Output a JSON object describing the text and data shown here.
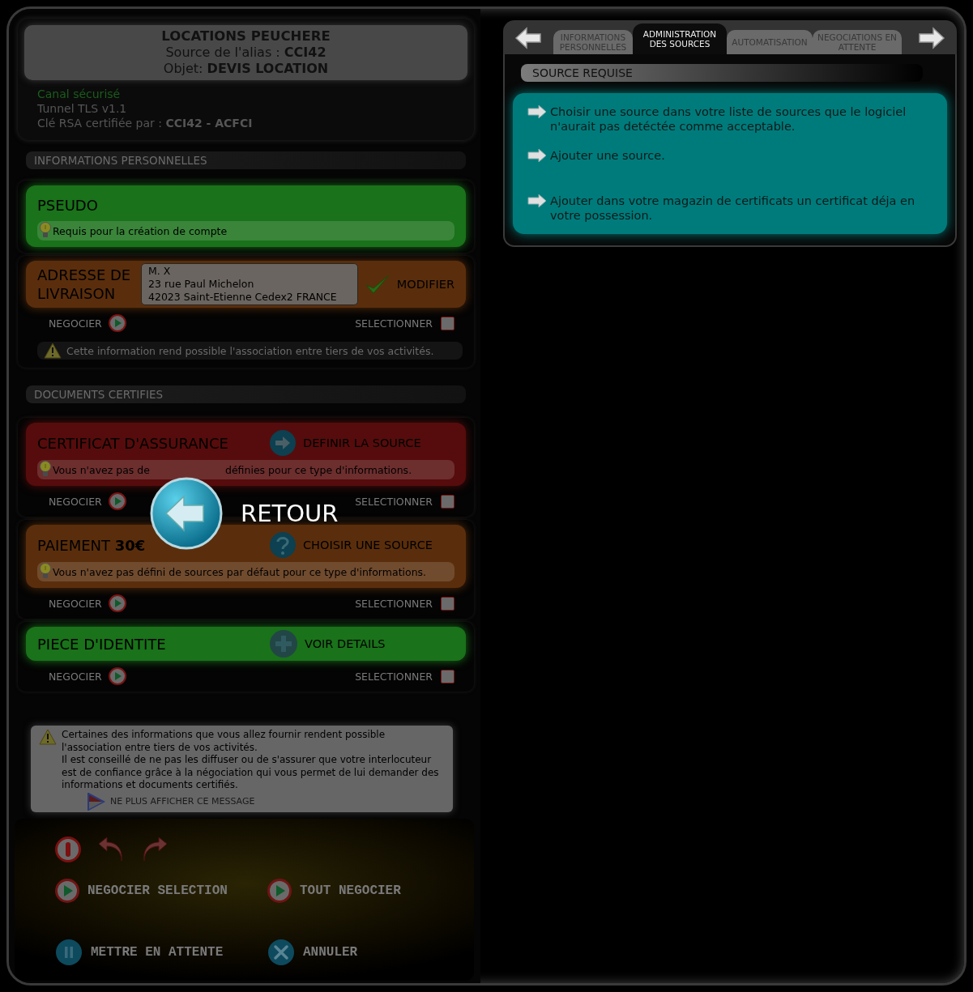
{
  "header": {
    "title": "LOCATIONS PEUCHERE",
    "alias": "Source de l'alias : **CCI42**",
    "object": "Objet: **DEVIS LOCATION**",
    "channel": "Canal sécurisé",
    "tunnel": "Tunnel TLS v1.1",
    "key": "Clé RSA certifiée par : **CCI42 - ACFCI**"
  },
  "sections": [
    {
      "title": "INFORMATIONS PERSONNELLES",
      "cards": [
        {
          "title": "PSEUDO",
          "color": "#1a721a",
          "hint": "Requis pour la création de compte"
        },
        {
          "title": "ADRESSE DE LIVRAISON",
          "color": "#5a2e0c",
          "address": [
            "M. X",
            "23 rue Paul Michelon",
            "42023 Saint-Etienne Cedex2 FRANCE"
          ],
          "action": {
            "kind": "check",
            "label": "MODIFIER"
          },
          "negotiate": "NEGOCIER",
          "select": {
            "label": "SELECTIONNER",
            "checked": false
          },
          "warning": "Cette information rend possible l'association entre tiers de vos activités."
        }
      ]
    },
    {
      "title": "DOCUMENTS CERTIFIES",
      "cards": [
        {
          "title": "CERTIFICAT D'ASSURANCE",
          "color": "#560c0c",
          "action": {
            "kind": "arrow",
            "label": "DEFINIR LA SOURCE"
          },
          "hint": "Vous n'avez pas de",
          "hint_tail": "définies pour ce type d'informations.",
          "negotiate": "NEGOCIER",
          "select": {
            "label": "SELECTIONNER",
            "checked": false
          }
        },
        {
          "title": "PAIEMENT **30€**",
          "color": "#5a2e0c",
          "action": {
            "kind": "question",
            "label": "CHOISIR UNE SOURCE"
          },
          "hint": "Vous n'avez pas défini de sources par défaut pour ce type d'informations.",
          "negotiate": "NEGOCIER",
          "select": {
            "label": "SELECTIONNER",
            "checked": false
          }
        },
        {
          "title": "PIECE D'IDENTITE",
          "color": "#1a721a",
          "action": {
            "kind": "plus",
            "label": "VOIR DETAILS"
          },
          "negotiate": "NEGOCIER",
          "select": {
            "label": "SELECTIONNER",
            "checked": false
          }
        }
      ]
    }
  ],
  "notice": {
    "paragraphs": [
      "Certaines des informations que vous allez fournir rendent possible l'association entre tiers de vos activités.",
      "Il est conseillé de ne pas les diffuser ou de s'assurer que votre interlocuteur est de confiance grâce à la négociation qui vous permet de lui demander des informations et documents certifiés."
    ],
    "dismiss": "NE PLUS AFFICHER CE MESSAGE"
  },
  "footer": {
    "buttons": [
      {
        "kind": "play",
        "label": "NEGOCIER SELECTION"
      },
      {
        "kind": "play",
        "label": "TOUT NEGOCIER"
      },
      {
        "kind": "pause",
        "label": "METTRE EN ATTENTE"
      },
      {
        "kind": "cancel",
        "label": "ANNULER"
      }
    ]
  },
  "tabs": [
    {
      "label": "INFORMATIONS PERSONNELLES",
      "selected": false
    },
    {
      "label": "ADMINISTRATION DES SOURCES",
      "selected": true
    },
    {
      "label": "AUTOMATISATION",
      "selected": false
    },
    {
      "label": "NEGOCIATIONS EN ATTENTE",
      "selected": false
    }
  ],
  "source_panel": {
    "title": "SOURCE REQUISE",
    "options": [
      "Choisir une source dans votre liste de sources que le logiciel n'aurait pas detéctée comme acceptable.",
      "Ajouter une source.",
      "Ajouter dans votre magazin de certificats un certificat déja en votre possession."
    ]
  },
  "overlay": {
    "label": "RETOUR"
  }
}
